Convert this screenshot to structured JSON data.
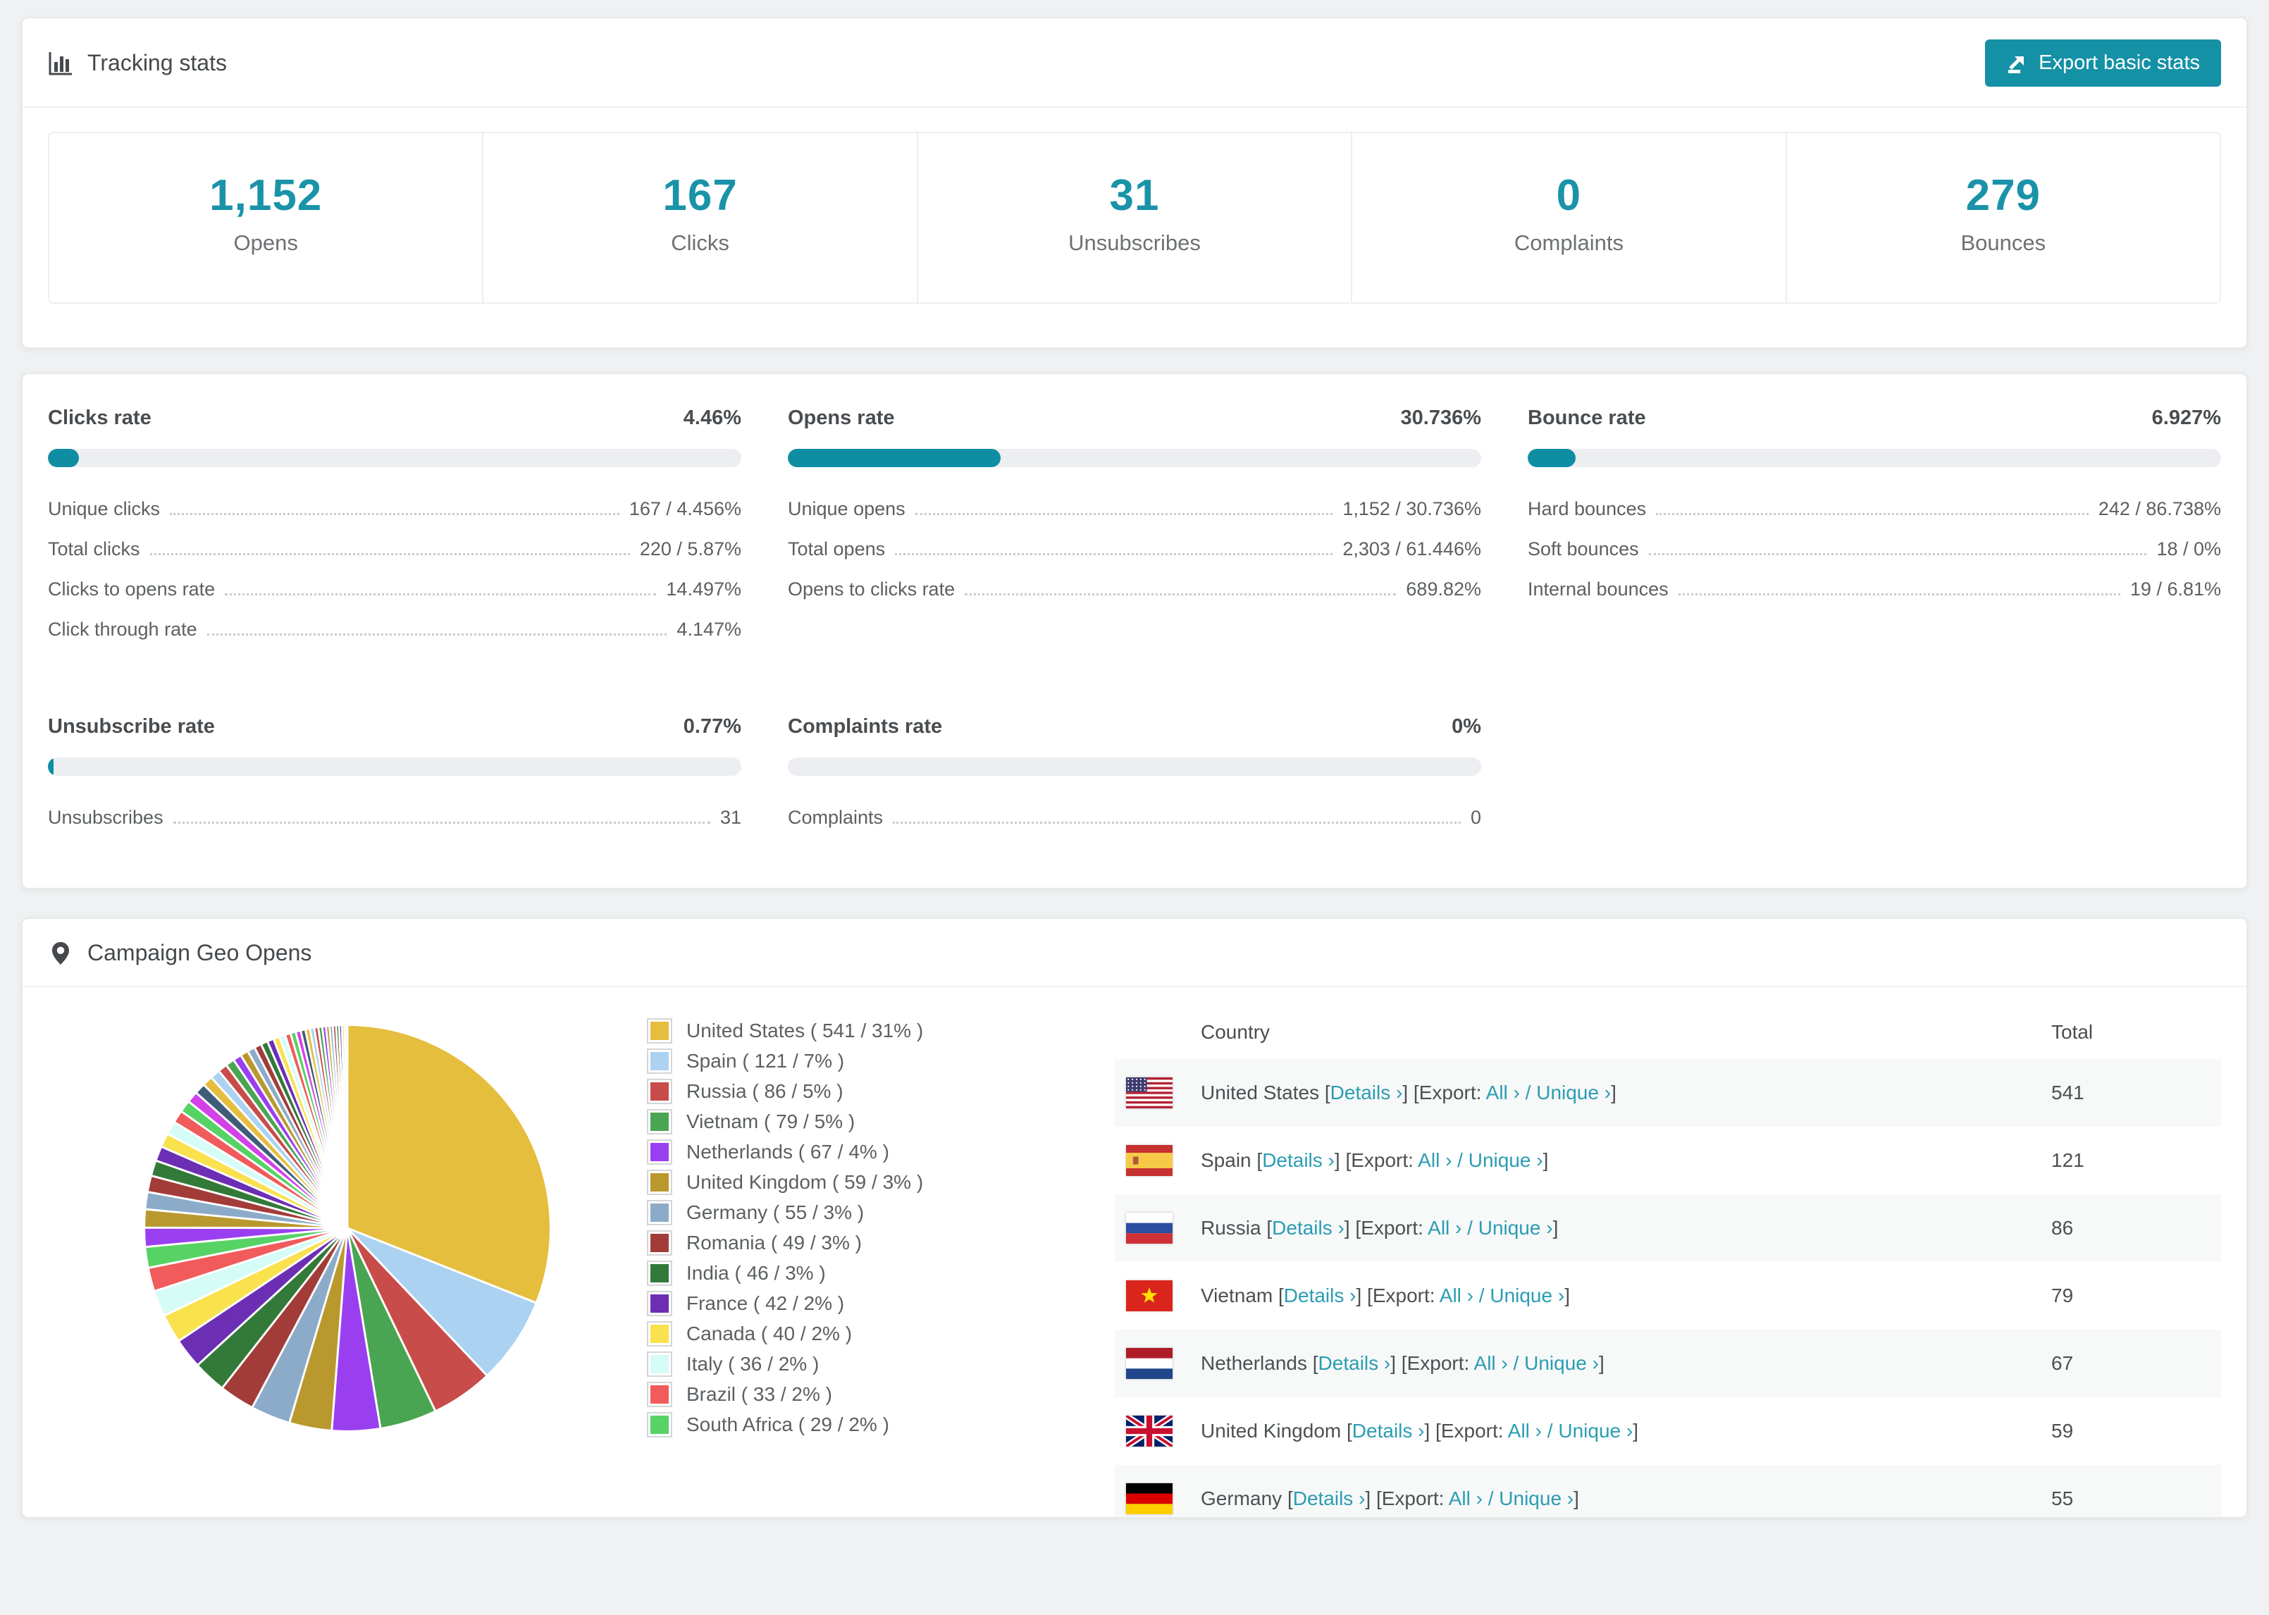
{
  "colors": {
    "accent_teal": "#1591a6",
    "number_teal": "#1a93a9",
    "link_teal": "#2a9db3",
    "progress_fill": "#0f8ea3",
    "progress_track": "#eceef1",
    "stripe_bg": "#f7f8f8",
    "page_bg": "#f0f1f2"
  },
  "tracking": {
    "title": "Tracking stats",
    "export_label": "Export basic stats",
    "summary": [
      {
        "value": "1,152",
        "label": "Opens"
      },
      {
        "value": "167",
        "label": "Clicks"
      },
      {
        "value": "31",
        "label": "Unsubscribes"
      },
      {
        "value": "0",
        "label": "Complaints"
      },
      {
        "value": "279",
        "label": "Bounces"
      }
    ]
  },
  "rates": [
    {
      "id": "clicks",
      "title": "Clicks rate",
      "value": "4.46%",
      "percent": 4.46,
      "rows": [
        {
          "label": "Unique clicks",
          "value": "167 / 4.456%"
        },
        {
          "label": "Total clicks",
          "value": "220 / 5.87%"
        },
        {
          "label": "Clicks to opens rate",
          "value": "14.497%"
        },
        {
          "label": "Click through rate",
          "value": "4.147%"
        }
      ]
    },
    {
      "id": "opens",
      "title": "Opens rate",
      "value": "30.736%",
      "percent": 30.736,
      "rows": [
        {
          "label": "Unique opens",
          "value": "1,152 / 30.736%"
        },
        {
          "label": "Total opens",
          "value": "2,303 / 61.446%"
        },
        {
          "label": "Opens to clicks rate",
          "value": "689.82%"
        }
      ]
    },
    {
      "id": "bounce",
      "title": "Bounce rate",
      "value": "6.927%",
      "percent": 6.927,
      "rows": [
        {
          "label": "Hard bounces",
          "value": "242 / 86.738%"
        },
        {
          "label": "Soft bounces",
          "value": "18 / 0%"
        },
        {
          "label": "Internal bounces",
          "value": "19 / 6.81%"
        }
      ]
    },
    {
      "id": "unsubscribe",
      "title": "Unsubscribe rate",
      "value": "0.77%",
      "percent": 0.77,
      "rows": [
        {
          "label": "Unsubscribes",
          "value": "31"
        }
      ]
    },
    {
      "id": "complaints",
      "title": "Complaints rate",
      "value": "0%",
      "percent": 0,
      "rows": [
        {
          "label": "Complaints",
          "value": "0"
        }
      ]
    }
  ],
  "geo": {
    "title": "Campaign Geo Opens",
    "chart_data": {
      "type": "pie",
      "title": "Campaign Geo Opens",
      "legend_position": "right",
      "labels": [
        "United States",
        "Spain",
        "Russia",
        "Vietnam",
        "Netherlands",
        "United Kingdom",
        "Germany",
        "Romania",
        "India",
        "France",
        "Canada",
        "Italy",
        "Brazil",
        "South Africa"
      ],
      "values": [
        541,
        121,
        86,
        79,
        67,
        59,
        55,
        49,
        46,
        42,
        40,
        36,
        33,
        29
      ],
      "percents": [
        31,
        7,
        5,
        5,
        4,
        3,
        3,
        3,
        3,
        2,
        2,
        2,
        2,
        2
      ],
      "colors": [
        "#e5be3d",
        "#abd2f1",
        "#c84c49",
        "#4aa552",
        "#9a3ff0",
        "#b9992e",
        "#8cabc9",
        "#a23c39",
        "#33793a",
        "#6c2fb4",
        "#fae14e",
        "#d5fcf6",
        "#f15b5b",
        "#57d265"
      ],
      "others": {
        "total": 462,
        "approx_slices": 40,
        "note": "long tail of unlabeled small slices"
      }
    },
    "table": {
      "header_country": "Country",
      "header_total": "Total",
      "link_labels": {
        "details": "Details",
        "export": "Export:",
        "all": "All",
        "unique": "Unique",
        "chevron": "›"
      },
      "rows": [
        {
          "country": "United States",
          "total": "541",
          "flag": "us"
        },
        {
          "country": "Spain",
          "total": "121",
          "flag": "es"
        },
        {
          "country": "Russia",
          "total": "86",
          "flag": "ru"
        },
        {
          "country": "Vietnam",
          "total": "79",
          "flag": "vn"
        },
        {
          "country": "Netherlands",
          "total": "67",
          "flag": "nl"
        },
        {
          "country": "United Kingdom",
          "total": "59",
          "flag": "gb"
        },
        {
          "country": "Germany",
          "total": "55",
          "flag": "de"
        }
      ]
    }
  }
}
